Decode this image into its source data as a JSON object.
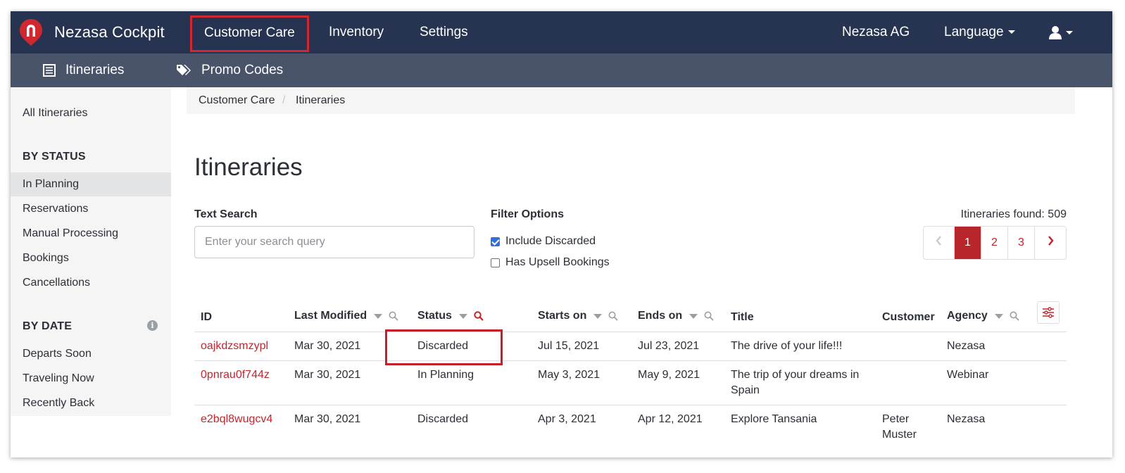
{
  "app": {
    "name": "Nezasa Cockpit",
    "brand_color": "#d0282e"
  },
  "topnav": {
    "items": [
      {
        "label": "Customer Care"
      },
      {
        "label": "Inventory"
      },
      {
        "label": "Settings"
      }
    ],
    "company": "Nezasa AG",
    "language": "Language",
    "user_icon": "user-icon"
  },
  "subnav": {
    "items": [
      {
        "label": "Itineraries",
        "icon": "list-icon"
      },
      {
        "label": "Promo Codes",
        "icon": "tags-icon"
      }
    ]
  },
  "sidebar": {
    "all": "All Itineraries",
    "by_status": {
      "heading": "BY STATUS",
      "items": [
        "In Planning",
        "Reservations",
        "Manual Processing",
        "Bookings",
        "Cancellations"
      ],
      "active": "In Planning"
    },
    "by_date": {
      "heading": "BY DATE",
      "items": [
        "Departs Soon",
        "Traveling Now",
        "Recently Back"
      ]
    }
  },
  "breadcrumb": [
    "Customer Care",
    "Itineraries"
  ],
  "page_title": "Itineraries",
  "search": {
    "label": "Text Search",
    "placeholder": "Enter your search query",
    "value": ""
  },
  "filters": {
    "label": "Filter Options",
    "options": [
      {
        "label": "Include Discarded",
        "checked": true
      },
      {
        "label": "Has Upsell Bookings",
        "checked": false
      }
    ]
  },
  "results": {
    "found_text": "Itineraries found: 509"
  },
  "pagination": {
    "pages": [
      "1",
      "2",
      "3"
    ],
    "current": "1"
  },
  "table": {
    "columns": [
      "ID",
      "Last Modified",
      "Status",
      "Starts on",
      "Ends on",
      "Title",
      "Customer",
      "Agency"
    ],
    "rows": [
      {
        "id": "oajkdzsmzypl",
        "last_modified": "Mar 30, 2021",
        "status": "Discarded",
        "starts_on": "Jul 15, 2021",
        "ends_on": "Jul 23, 2021",
        "title": [
          "The drive of your life!!!",
          ""
        ],
        "customer": [
          "",
          ""
        ],
        "agency": "Nezasa"
      },
      {
        "id": "0pnrau0f744z",
        "last_modified": "Mar 30, 2021",
        "status": "In Planning",
        "starts_on": "May 3, 2021",
        "ends_on": "May 9, 2021",
        "title": [
          "The trip of your dreams in",
          "Spain"
        ],
        "customer": [
          "",
          ""
        ],
        "agency": "Webinar"
      },
      {
        "id": "e2bql8wugcv4",
        "last_modified": "Mar 30, 2021",
        "status": "Discarded",
        "starts_on": "Apr 3, 2021",
        "ends_on": "Apr 12, 2021",
        "title": [
          "Explore Tansania",
          ""
        ],
        "customer": [
          "Peter",
          "Muster"
        ],
        "agency": "Nezasa"
      }
    ]
  }
}
